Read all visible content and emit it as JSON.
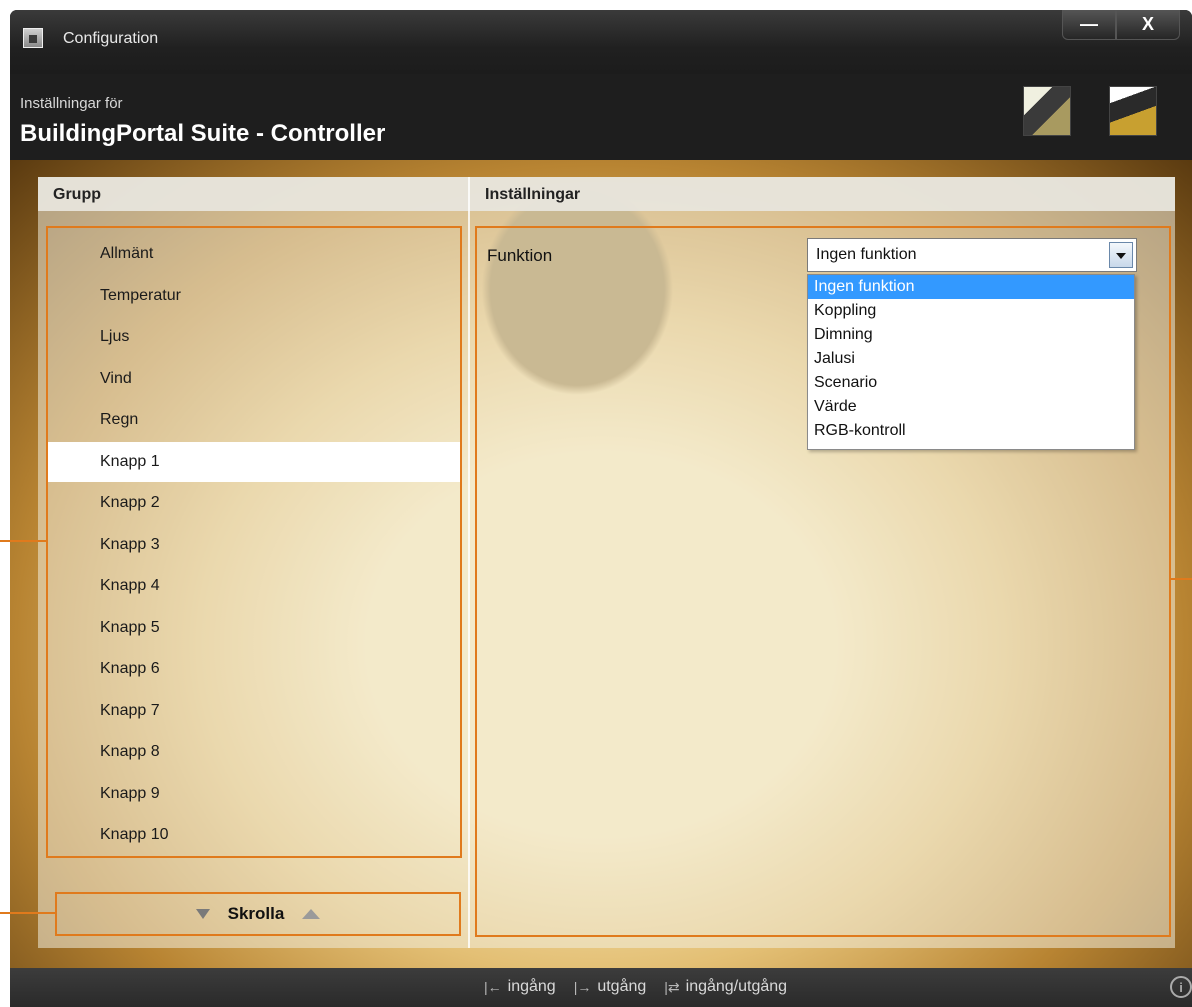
{
  "window": {
    "title": "Configuration"
  },
  "window_controls": {
    "minimize": "—",
    "close": "X"
  },
  "header": {
    "subtitle": "Inställningar för",
    "title": "BuildingPortal Suite - Controller"
  },
  "columns": {
    "group": "Grupp",
    "settings": "Inställningar"
  },
  "group_items": [
    "Allmänt",
    "Temperatur",
    "Ljus",
    "Vind",
    "Regn",
    "Knapp 1",
    "Knapp 2",
    "Knapp 3",
    "Knapp 4",
    "Knapp 5",
    "Knapp 6",
    "Knapp 7",
    "Knapp 8",
    "Knapp 9",
    "Knapp 10"
  ],
  "selected_group": "Knapp 1",
  "scroll": {
    "label": "Skrolla"
  },
  "settings": {
    "function_label": "Funktion",
    "function_value": "Ingen funktion",
    "function_options": [
      "Ingen funktion",
      "Koppling",
      "Dimning",
      "Jalusi",
      "Scenario",
      "Värde",
      "RGB-kontroll"
    ],
    "highlighted_option": "Ingen funktion"
  },
  "footer": {
    "legend": [
      {
        "glyph": "|←",
        "label": "ingång"
      },
      {
        "glyph": "|→",
        "label": "utgång"
      },
      {
        "glyph": "|⇄",
        "label": "ingång/utgång"
      }
    ],
    "info": "i"
  },
  "colors": {
    "callout": "#e07a1c",
    "highlight": "#3399ff"
  }
}
